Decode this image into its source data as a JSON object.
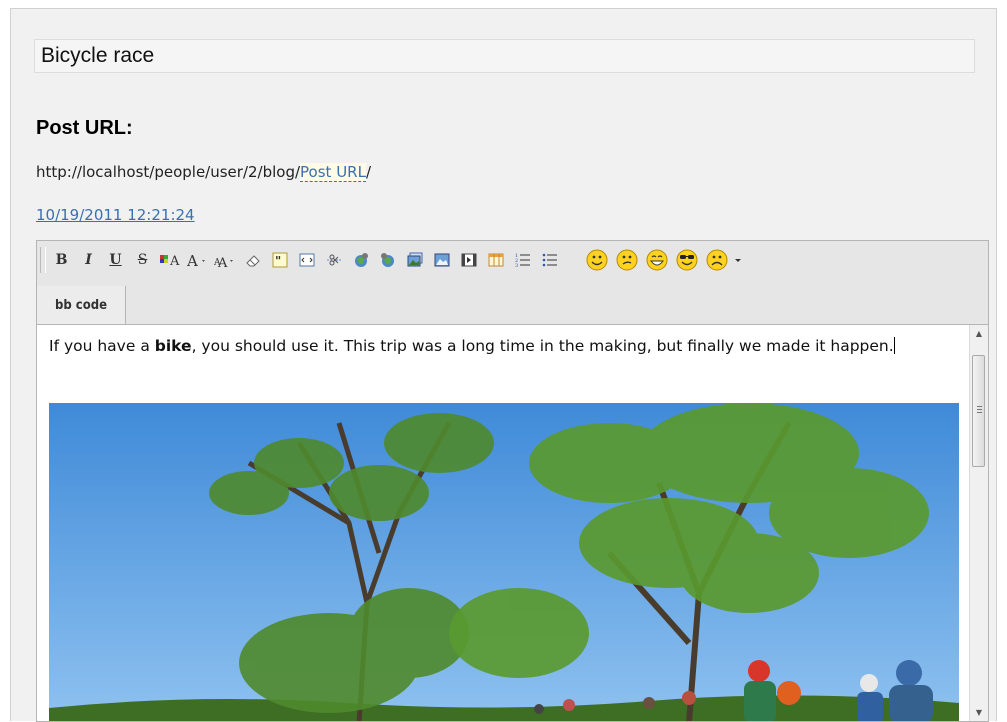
{
  "post": {
    "title": "Bicycle race",
    "url_heading": "Post URL:",
    "url_prefix": "http://localhost/people/user/2/blog/",
    "url_slug": "Post URL",
    "url_suffix": "/",
    "date": "10/19/2011 12:21:24"
  },
  "toolbar": {
    "buttons": [
      {
        "name": "bold",
        "label": "B"
      },
      {
        "name": "italic",
        "label": "I"
      },
      {
        "name": "underline",
        "label": "U"
      },
      {
        "name": "strikethrough",
        "label": "S"
      },
      {
        "name": "font-color",
        "label": "A"
      },
      {
        "name": "font-size-up",
        "label": "A"
      },
      {
        "name": "font-size-down",
        "label": "A"
      },
      {
        "name": "eraser-icon"
      },
      {
        "name": "quote-icon"
      },
      {
        "name": "code-icon"
      },
      {
        "name": "spoiler-icon"
      },
      {
        "name": "link-icon"
      },
      {
        "name": "unlink-icon"
      },
      {
        "name": "image-gallery-icon"
      },
      {
        "name": "image-icon"
      },
      {
        "name": "video-icon"
      },
      {
        "name": "table-icon"
      },
      {
        "name": "ordered-list-icon"
      },
      {
        "name": "unordered-list-icon"
      },
      {
        "name": "smile-icon"
      },
      {
        "name": "confused-icon"
      },
      {
        "name": "laugh-icon"
      },
      {
        "name": "cool-icon"
      },
      {
        "name": "sad-icon"
      },
      {
        "name": "more-smileys-icon"
      }
    ],
    "bbcode_label": "bb code"
  },
  "editor": {
    "text_before": "If you have a ",
    "text_bold": "bike",
    "text_after": ", you should use it. This trip was a long time in the making, but finally we made it happen.",
    "image": "photo of cyclists under tall trees beneath a blue sky"
  },
  "colors": {
    "link": "#3a6fb0",
    "smiley_fill": "#ffd21f",
    "sky": "#5a9fe0",
    "foliage": "#4f8a2c"
  }
}
